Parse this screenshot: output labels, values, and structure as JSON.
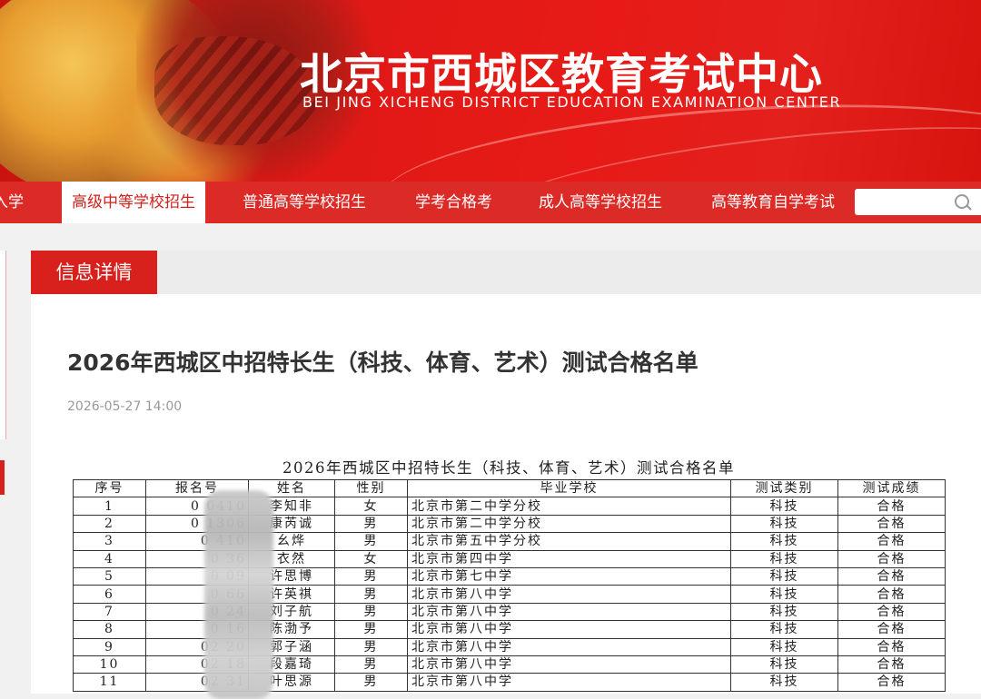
{
  "banner": {
    "title_cn": "北京市西城区教育考试中心",
    "title_en": "BEI JING XICHENG DISTRICT EDUCATION EXAMINATION  CENTER"
  },
  "nav": {
    "items": [
      {
        "label": "入学",
        "active": false
      },
      {
        "label": "高级中等学校招生",
        "active": true
      },
      {
        "label": "普通高等学校招生",
        "active": false
      },
      {
        "label": "学考合格考",
        "active": false
      },
      {
        "label": "成人高等学校招生",
        "active": false
      },
      {
        "label": "高等教育自学考试",
        "active": false
      }
    ],
    "search_placeholder": ""
  },
  "section": {
    "tab_label": "信息详情"
  },
  "article": {
    "title": "2026年西城区中招特长生（科技、体育、艺术）测试合格名单",
    "date": "2026-05-27 14:00"
  },
  "table": {
    "title": "2026年西城区中招特长生（科技、体育、艺术）测试合格名单",
    "headers": [
      "序号",
      "报名号",
      "姓名",
      "性别",
      "毕业学校",
      "测试类别",
      "测试成绩"
    ],
    "rows": [
      [
        "1",
        "0      0410",
        "李知非",
        "女",
        "北京市第二中学分校",
        "科技",
        "合格"
      ],
      [
        "2",
        "0      1306",
        "康芮诚",
        "男",
        "北京市第二中学分校",
        "科技",
        "合格"
      ],
      [
        "3",
        "0      410",
        "幺烨",
        "男",
        "北京市第五中学分校",
        "科技",
        "合格"
      ],
      [
        "4",
        "0      36",
        "衣然",
        "女",
        "北京市第四中学",
        "科技",
        "合格"
      ],
      [
        "5",
        "0      09",
        "许思博",
        "男",
        "北京市第七中学",
        "科技",
        "合格"
      ],
      [
        "6",
        "0      66",
        "许英祺",
        "男",
        "北京市第八中学",
        "科技",
        "合格"
      ],
      [
        "7",
        "0      24",
        "刘子航",
        "男",
        "北京市第八中学",
        "科技",
        "合格"
      ],
      [
        "8",
        "0      16",
        "陈渤予",
        "男",
        "北京市第八中学",
        "科技",
        "合格"
      ],
      [
        "9",
        "02      20",
        "郭子涵",
        "男",
        "北京市第八中学",
        "科技",
        "合格"
      ],
      [
        "10",
        "02      18",
        "段嘉琦",
        "男",
        "北京市第八中学",
        "科技",
        "合格"
      ],
      [
        "11",
        "02      31",
        "叶思源",
        "男",
        "北京市第八中学",
        "科技",
        "合格"
      ]
    ]
  },
  "colors": {
    "brand_red": "#d8201c",
    "nav_red": "#dc2a26"
  }
}
